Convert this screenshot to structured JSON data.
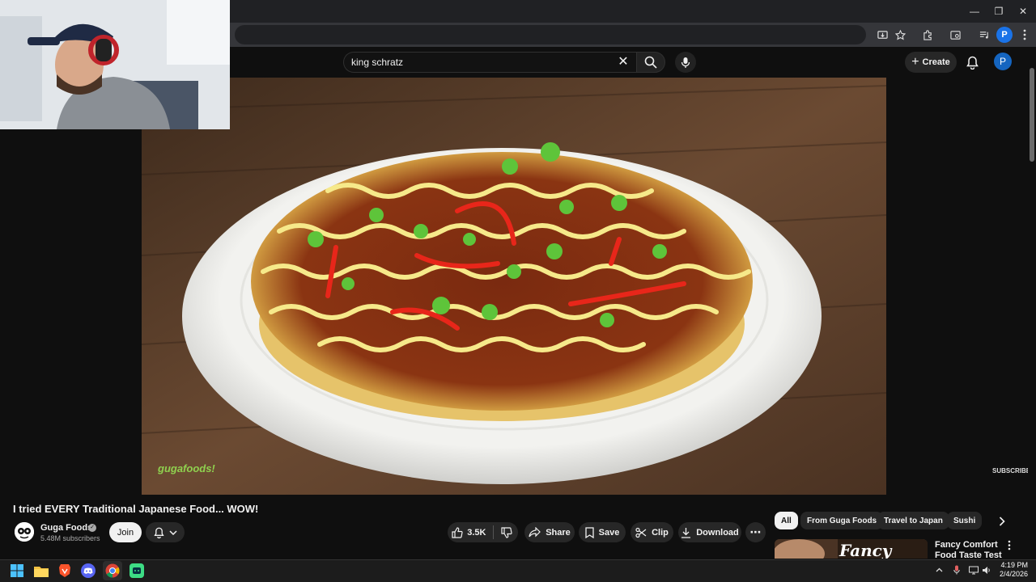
{
  "browser": {
    "window_controls": {
      "minimize": "—",
      "restore": "❐",
      "close": "✕"
    },
    "profile_initial": "P"
  },
  "youtube": {
    "search": {
      "query": "king schratz"
    },
    "create_label": "Create",
    "avatar_initial": "P"
  },
  "video": {
    "watermark": "gugafoods!",
    "subscribe_watermark": "SUBSCRIBE",
    "title": "I tried EVERY Traditional Japanese Food... WOW!"
  },
  "channel": {
    "name": "Guga Foods",
    "verified_mark": "✓",
    "subscribers": "5.48M subscribers",
    "join_label": "Join"
  },
  "actions": {
    "likes": "3.5K",
    "share": "Share",
    "save": "Save",
    "clip": "Clip",
    "download": "Download",
    "more": "⋯"
  },
  "chips": [
    "All",
    "From Guga Foods",
    "Travel to Japan",
    "Sushi"
  ],
  "recommendation": {
    "title": "Fancy Comfort Food Taste Test",
    "thumb_text": "Fancy"
  },
  "taskbar": {
    "time": "4:19 PM",
    "date": "2/4/2026",
    "apps": [
      "windows-start",
      "file-explorer",
      "brave",
      "discord",
      "chrome",
      "android-studio"
    ]
  },
  "colors": {
    "background": "#0f0f0f",
    "chip_bg": "#272727",
    "accent_blue": "#1a73e8"
  }
}
